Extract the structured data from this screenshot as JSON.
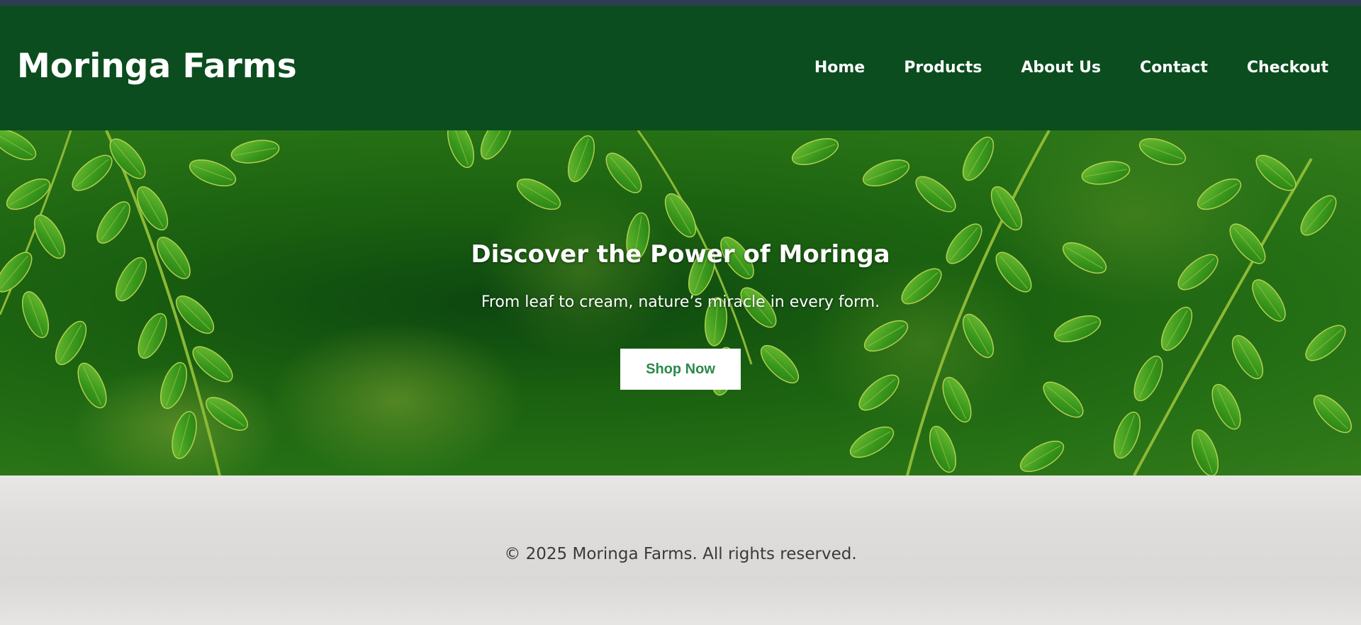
{
  "header": {
    "brand": "Moringa Farms",
    "nav": [
      {
        "label": "Home"
      },
      {
        "label": "Products"
      },
      {
        "label": "About Us"
      },
      {
        "label": "Contact"
      },
      {
        "label": "Checkout"
      }
    ]
  },
  "hero": {
    "title": "Discover the Power of Moringa",
    "subtitle": "From leaf to cream, nature’s miracle in every form.",
    "cta_label": "Shop Now"
  },
  "footer": {
    "copyright": "© 2025 Moringa Farms. All rights reserved."
  },
  "colors": {
    "header_bg": "#0b4d1e",
    "top_strip": "#2e3e52",
    "cta_text": "#2a8a4a",
    "footer_bg": "#dedddb"
  }
}
